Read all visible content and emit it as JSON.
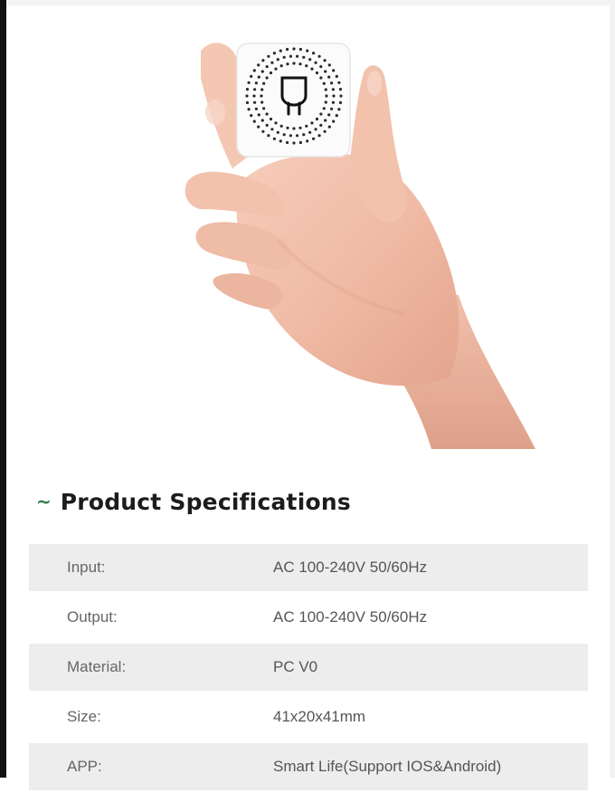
{
  "hero": {
    "image_description": "hand holding smart switch module",
    "device_icon": "plug-icon"
  },
  "section": {
    "tilde": "~",
    "title": "Product Specifications"
  },
  "specs": [
    {
      "label": "Input:",
      "value": "AC 100-240V 50/60Hz"
    },
    {
      "label": "Output:",
      "value": "AC 100-240V 50/60Hz"
    },
    {
      "label": "Material:",
      "value": "PC V0"
    },
    {
      "label": "Size:",
      "value": "41x20x41mm"
    },
    {
      "label": "APP:",
      "value": "Smart Life(Support IOS&Android)"
    }
  ],
  "colors": {
    "accent": "#2e7d4a",
    "row_shade": "#ededed"
  }
}
